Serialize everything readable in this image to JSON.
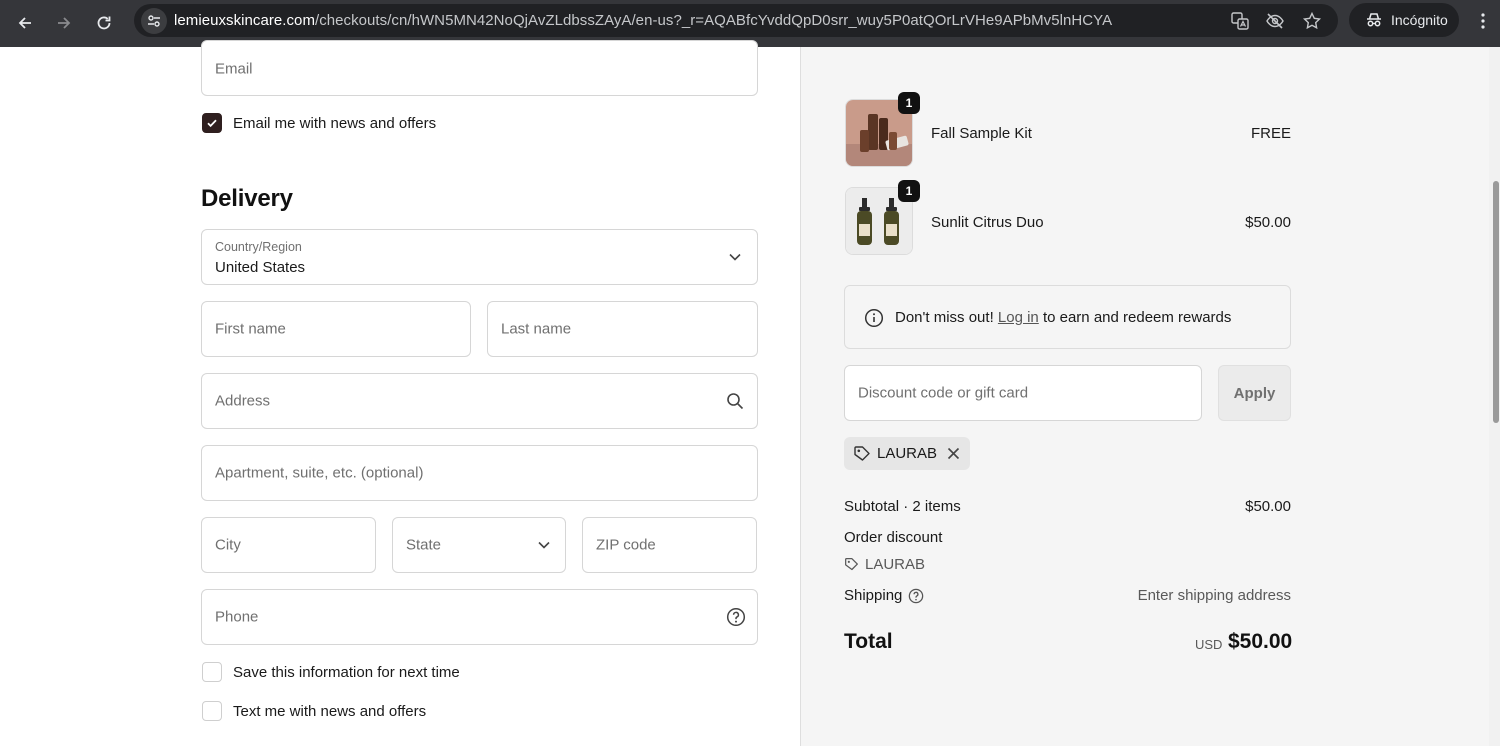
{
  "browser": {
    "url_host": "lemieuxskincare.com",
    "url_path": "/checkouts/cn/hWN5MN42NoQjAvZLdbssZAyA/en-us?_r=AQABfcYvddQpD0srr_wuy5P0atQOrLrVHe9APbMv5lnHCYA",
    "incognito_label": "Incógnito",
    "icons": [
      "back-icon",
      "forward-icon",
      "reload-icon",
      "site-info-icon",
      "translate-icon",
      "eye-off-icon",
      "star-icon",
      "incognito-icon",
      "kebab-icon"
    ]
  },
  "contact": {
    "email_placeholder": "Email",
    "email_news_label": "Email me with news and offers",
    "email_news_checked": true
  },
  "delivery": {
    "heading": "Delivery",
    "country_label": "Country/Region",
    "country_value": "United States",
    "first_name_placeholder": "First name",
    "last_name_placeholder": "Last name",
    "address_placeholder": "Address",
    "apartment_placeholder": "Apartment, suite, etc. (optional)",
    "city_placeholder": "City",
    "state_placeholder": "State",
    "zip_placeholder": "ZIP code",
    "phone_placeholder": "Phone",
    "save_info_label": "Save this information for next time",
    "text_news_label": "Text me with news and offers"
  },
  "cart": {
    "items": [
      {
        "name": "Fall Sample Kit",
        "price": "FREE",
        "qty": "1"
      },
      {
        "name": "Sunlit Citrus Duo",
        "price": "$50.00",
        "qty": "1"
      }
    ],
    "rewards_prefix": "Don't miss out! ",
    "rewards_link": "Log in",
    "rewards_suffix": " to earn and redeem rewards",
    "discount_placeholder": "Discount code or gift card",
    "apply_label": "Apply",
    "applied_code": "LAURAB"
  },
  "summary": {
    "subtotal_label": "Subtotal · 2 items",
    "subtotal_value": "$50.00",
    "discount_label": "Order discount",
    "discount_code": "LAURAB",
    "shipping_label": "Shipping",
    "shipping_value": "Enter shipping address",
    "total_label": "Total",
    "total_currency": "USD",
    "total_value": "$50.00"
  },
  "colors": {
    "checkbox_checked": "#2f1f1f",
    "sidebar_bg": "#f5f5f5",
    "chrome_bg": "#35363a"
  }
}
